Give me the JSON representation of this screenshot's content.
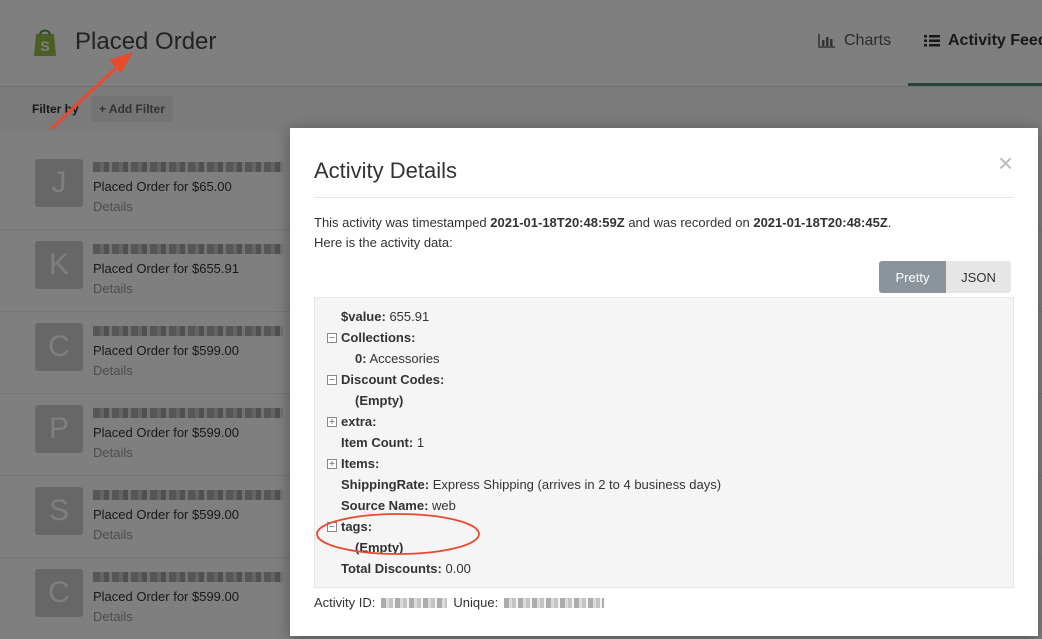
{
  "header": {
    "page_title": "Placed Order",
    "nav": {
      "charts": "Charts",
      "activity_feed": "Activity Feed"
    },
    "brand_color": "#95bf47",
    "active_tab_color": "#4a8a7a"
  },
  "filter": {
    "label": "Filter by",
    "add_filter": "+ Add Filter"
  },
  "feed": {
    "items": [
      {
        "initial": "J",
        "action": "Placed Order for $65.00",
        "details": "Details"
      },
      {
        "initial": "K",
        "action": "Placed Order for $655.91",
        "details": "Details"
      },
      {
        "initial": "C",
        "action": "Placed Order for $599.00",
        "details": "Details"
      },
      {
        "initial": "P",
        "action": "Placed Order for $599.00",
        "details": "Details"
      },
      {
        "initial": "S",
        "action": "Placed Order for $599.00",
        "details": "Details"
      },
      {
        "initial": "C",
        "action": "Placed Order for $599.00",
        "details": "Details"
      }
    ]
  },
  "modal": {
    "title": "Activity Details",
    "close_glyph": "×",
    "timestamp": {
      "prefix": "This activity was timestamped ",
      "timestamped_at": "2021-01-18T20:48:59Z",
      "middle": " and was recorded on ",
      "recorded_at": "2021-01-18T20:48:45Z",
      "suffix": "."
    },
    "intro": "Here is the activity data:",
    "view_toggle": {
      "pretty": "Pretty",
      "json": "JSON",
      "selected": "Pretty"
    },
    "data": {
      "value_key": "$value:",
      "value": "655.91",
      "collections_key": "Collections:",
      "collections_item_key": "0:",
      "collections_item_value": "Accessories",
      "discount_codes_key": "Discount Codes:",
      "discount_codes_value": "(Empty)",
      "extra_key": "extra:",
      "item_count_key": "Item Count:",
      "item_count_value": "1",
      "items_key": "Items:",
      "shipping_rate_key": "ShippingRate:",
      "shipping_rate_value": "Express Shipping (arrives in 2 to 4 business days)",
      "source_name_key": "Source Name:",
      "source_name_value": "web",
      "tags_key": "tags:",
      "tags_value": "(Empty)",
      "total_discounts_key": "Total Discounts:",
      "total_discounts_value": "0.00"
    },
    "footer": {
      "activity_id_label": "Activity ID:",
      "unique_label": "Unique:"
    }
  },
  "annotation_color": "#e84a2f"
}
